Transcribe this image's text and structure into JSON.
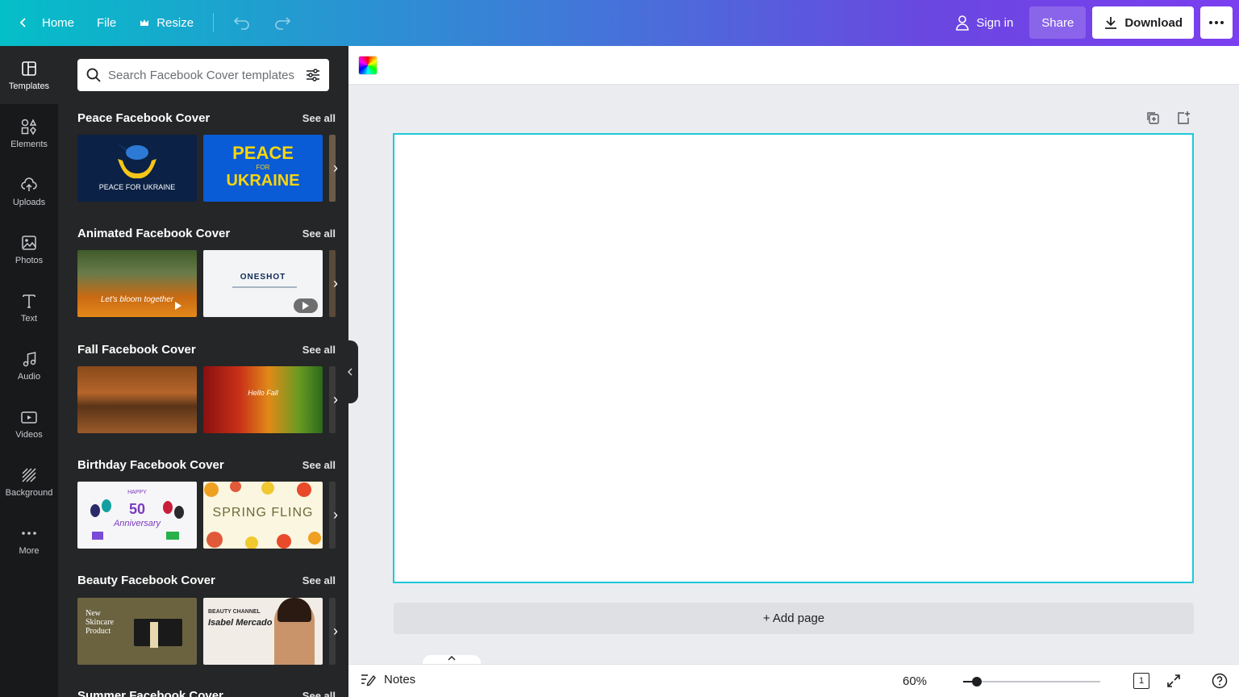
{
  "topbar": {
    "home_label": "Home",
    "file_label": "File",
    "resize_label": "Resize",
    "sign_in_label": "Sign in",
    "share_label": "Share",
    "download_label": "Download"
  },
  "rail": {
    "items": [
      {
        "label": "Templates",
        "icon": "templates-icon"
      },
      {
        "label": "Elements",
        "icon": "elements-icon"
      },
      {
        "label": "Uploads",
        "icon": "upload-cloud-icon"
      },
      {
        "label": "Photos",
        "icon": "photo-icon"
      },
      {
        "label": "Text",
        "icon": "text-icon"
      },
      {
        "label": "Audio",
        "icon": "music-note-icon"
      },
      {
        "label": "Videos",
        "icon": "video-icon"
      },
      {
        "label": "Background",
        "icon": "background-icon"
      },
      {
        "label": "More",
        "icon": "more-dots-icon"
      }
    ]
  },
  "panel": {
    "search_placeholder": "Search Facebook Cover templates",
    "see_all": "See all",
    "sections": [
      {
        "title": "Peace Facebook Cover",
        "t1_text": "PEACE FOR UKRAINE",
        "t2_text_a": "PEACE",
        "t2_text_b": "FOR",
        "t2_text_c": "UKRAINE"
      },
      {
        "title": "Animated Facebook Cover",
        "t1_text": "Let's bloom together",
        "t2_text": "ONESHOT"
      },
      {
        "title": "Fall Facebook Cover",
        "t2_text": "Hello Fall"
      },
      {
        "title": "Birthday Facebook Cover",
        "t1_text_a": "HAPPY",
        "t1_text_b": "50",
        "t1_text_c": "Anniversary",
        "t2_text": "SPRING FLING"
      },
      {
        "title": "Beauty Facebook Cover",
        "t1_text": "New Skincare Product",
        "t2_text_a": "BEAUTY CHANNEL",
        "t2_text_b": "Isabel Mercado"
      },
      {
        "title": "Summer Facebook Cover"
      }
    ]
  },
  "canvas": {
    "add_page_label": "+ Add page",
    "accent": "#1dc9d8"
  },
  "bottombar": {
    "notes_label": "Notes",
    "zoom": "60%",
    "zoom_fraction": 0.1,
    "page_count": "1"
  }
}
